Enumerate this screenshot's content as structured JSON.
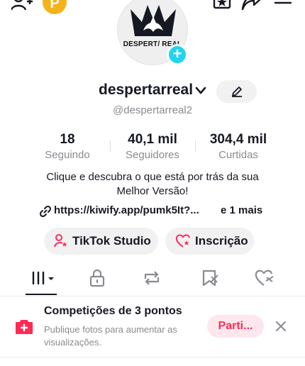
{
  "icons": {
    "add_friend": "person-plus-icon",
    "coin": "coin-icon",
    "favorites": "bookmark-star-icon",
    "share": "share-icon",
    "menu": "hamburger-menu-icon"
  },
  "top": {
    "coin_letter": "P"
  },
  "profile": {
    "avatar_text": "DESPERT/ REAL",
    "username": "despertarreal",
    "handle": "@despertarreal2"
  },
  "stats": [
    {
      "value": "18",
      "label": "Seguindo"
    },
    {
      "value": "40,1 mil",
      "label": "Seguidores"
    },
    {
      "value": "304,4 mil",
      "label": "Curtidas"
    }
  ],
  "bio": {
    "line1": "Clique e descubra o que está por trás da sua",
    "line2": "Melhor Versão!"
  },
  "link": {
    "url": "https://kiwify.app/pumk5It?...",
    "more": "e 1 mais"
  },
  "buttons": {
    "studio": "TikTok Studio",
    "subscription": "Inscrição"
  },
  "tabs": [
    "videos",
    "private",
    "reposts",
    "favorites",
    "liked"
  ],
  "banner": {
    "title": "Competições de 3 pontos",
    "subtitle": "Publique fotos para aumentar as visualizações.",
    "button": "Parti..."
  },
  "colors": {
    "accent_red": "#fe2c55",
    "cyan": "#20d5ec",
    "coin": "#f6b21b",
    "muted": "#8a8b91"
  }
}
